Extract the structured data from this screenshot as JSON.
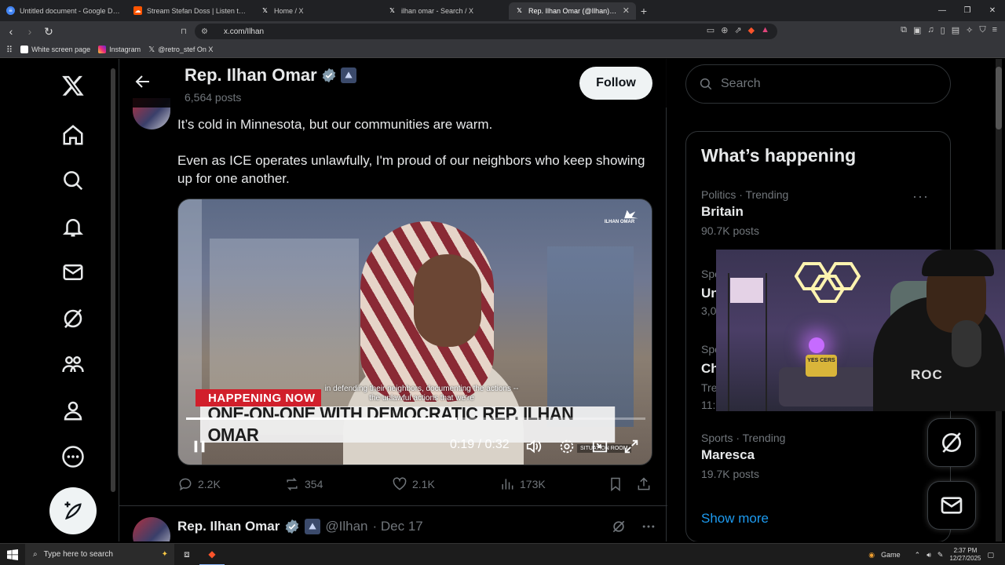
{
  "browser": {
    "tabs": [
      {
        "label": "Untitled document - Google Docs",
        "icon": "google-docs-icon",
        "color": "#4285f4",
        "active": false
      },
      {
        "label": "Stream Stefan Doss | Listen to Decen",
        "icon": "soundcloud-icon",
        "color": "#ff5500",
        "active": false
      },
      {
        "label": "Home / X",
        "icon": "x-icon",
        "color": "#000000",
        "active": false
      },
      {
        "label": "ilhan omar - Search / X",
        "icon": "x-icon",
        "color": "#000000",
        "active": false
      },
      {
        "label": "Rep. Ilhan Omar (@Ilhan) / X",
        "icon": "x-icon",
        "color": "#000000",
        "active": true
      }
    ],
    "url": "x.com/Ilhan",
    "bookmarks": [
      {
        "label": "White screen page",
        "color": "#ffffff"
      },
      {
        "label": "Instagram",
        "color": "#e1306c"
      },
      {
        "label": "@retro_stef On X",
        "color": "#000000"
      }
    ]
  },
  "profile": {
    "name": "Rep. Ilhan Omar",
    "posts": "6,564 posts",
    "follow_label": "Follow"
  },
  "tweet": {
    "line1": "It’s cold in Minnesota, but our communities are warm.",
    "line2": "Even as ICE operates unlawfully, I'm proud of our neighbors who keep showing up for one another.",
    "video": {
      "logo": "ILHAN OMAR",
      "caption": "in defending their neighbors, documenting the actions -- the unlawful actions that we're",
      "banner_red": "HAPPENING NOW",
      "banner_white": "ONE-ON-ONE WITH DEMOCRATIC REP. ILHAN OMAR",
      "time": "0:19 / 0:32",
      "progress": 0.59,
      "sub_logo": "SITUATION ROOM"
    },
    "stats": {
      "replies": "2.2K",
      "reposts": "354",
      "likes": "2.1K",
      "views": "173K"
    }
  },
  "tweet2": {
    "name": "Rep. Ilhan Omar",
    "handle": "@Ilhan",
    "date": "· Dec 17"
  },
  "search": {
    "placeholder": "Search"
  },
  "trends": {
    "title": "What’s happening",
    "items": [
      {
        "category": "Politics · Trending",
        "name": "Britain",
        "count": "90.7K posts"
      },
      {
        "category": "Sports · Trending",
        "name": "Maresca",
        "count": "19.7K posts"
      }
    ],
    "hidden_fragments": [
      "Spo",
      "Un",
      "3,0",
      "Spo",
      "Ch",
      "Tre",
      "11:"
    ],
    "show_more": "Show more"
  },
  "webcam": {
    "pillow_text": "YES CERS",
    "shirt_text": "ROC"
  },
  "taskbar": {
    "search_placeholder": "Type here to search",
    "game_label": "Game",
    "time": "2:37 PM",
    "date": "12/27/2025"
  }
}
